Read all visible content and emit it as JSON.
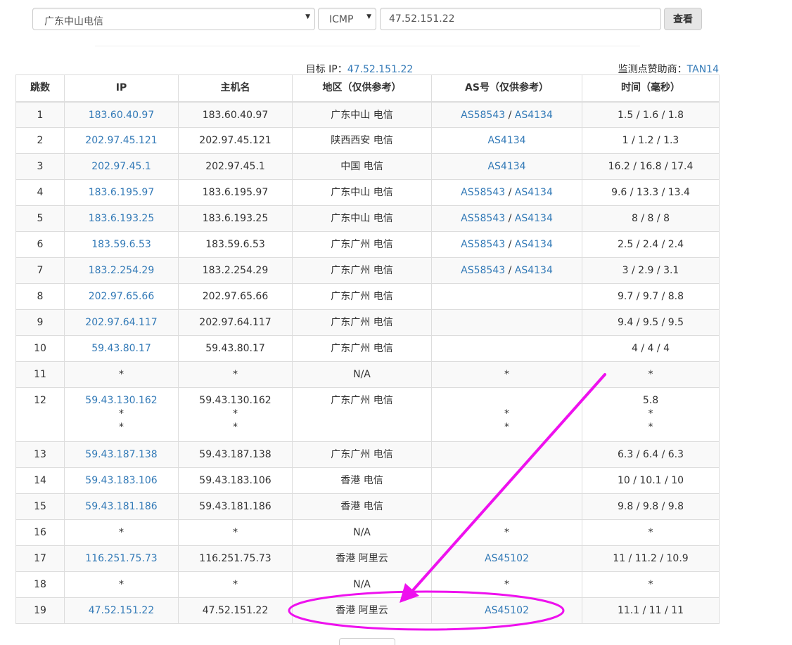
{
  "toolbar": {
    "region_select": {
      "value": "广东中山电信"
    },
    "protocol_select": {
      "value": "ICMP"
    },
    "target_input": {
      "value": "47.52.151.22"
    },
    "view_label": "查看"
  },
  "target": {
    "label": "目标 IP：",
    "ip": "47.52.151.22"
  },
  "sponsor": {
    "label": "监测点赞助商：",
    "name": "TAN14"
  },
  "table": {
    "headers": [
      "跳数",
      "IP",
      "主机名",
      "地区（仅供参考）",
      "AS号（仅供参考）",
      "时间（毫秒）"
    ],
    "rows": [
      {
        "hop": "1",
        "ip": "183.60.40.97",
        "host": "183.60.40.97",
        "region": "广东中山 电信",
        "as1": "AS58543",
        "sep": " / ",
        "as2": "AS4134",
        "time": "1.5 / 1.6 / 1.8"
      },
      {
        "hop": "2",
        "ip": "202.97.45.121",
        "host": "202.97.45.121",
        "region": "陕西西安 电信",
        "as1": "AS4134",
        "sep": "",
        "as2": "",
        "time": "1 / 1.2 / 1.3"
      },
      {
        "hop": "3",
        "ip": "202.97.45.1",
        "host": "202.97.45.1",
        "region": "中国 电信",
        "as1": "AS4134",
        "sep": "",
        "as2": "",
        "time": "16.2 / 16.8 / 17.4"
      },
      {
        "hop": "4",
        "ip": "183.6.195.97",
        "host": "183.6.195.97",
        "region": "广东中山 电信",
        "as1": "AS58543",
        "sep": " / ",
        "as2": "AS4134",
        "time": "9.6 / 13.3 / 13.4"
      },
      {
        "hop": "5",
        "ip": "183.6.193.25",
        "host": "183.6.193.25",
        "region": "广东中山 电信",
        "as1": "AS58543",
        "sep": " / ",
        "as2": "AS4134",
        "time": "8 / 8 / 8"
      },
      {
        "hop": "6",
        "ip": "183.59.6.53",
        "host": "183.59.6.53",
        "region": "广东广州 电信",
        "as1": "AS58543",
        "sep": " / ",
        "as2": "AS4134",
        "time": "2.5 / 2.4 / 2.4"
      },
      {
        "hop": "7",
        "ip": "183.2.254.29",
        "host": "183.2.254.29",
        "region": "广东广州 电信",
        "as1": "AS58543",
        "sep": " / ",
        "as2": "AS4134",
        "time": "3 / 2.9 / 3.1"
      },
      {
        "hop": "8",
        "ip": "202.97.65.66",
        "host": "202.97.65.66",
        "region": "广东广州 电信",
        "as1": "",
        "sep": "",
        "as2": "",
        "time": "9.7 / 9.7 / 8.8"
      },
      {
        "hop": "9",
        "ip": "202.97.64.117",
        "host": "202.97.64.117",
        "region": "广东广州 电信",
        "as1": "",
        "sep": "",
        "as2": "",
        "time": "9.4 / 9.5 / 9.5"
      },
      {
        "hop": "10",
        "ip": "59.43.80.17",
        "host": "59.43.80.17",
        "region": "广东广州 电信",
        "as1": "",
        "sep": "",
        "as2": "",
        "time": "4 / 4 / 4"
      },
      {
        "hop": "11",
        "ip_plain": "*",
        "host": "*",
        "region": "N/A",
        "as_plain": "*",
        "time": "*"
      },
      {
        "hop": "12",
        "ip": "59.43.130.162",
        "ip_extra1": "*",
        "ip_extra2": "*",
        "host": "59.43.130.162",
        "host_extra1": "*",
        "host_extra2": "*",
        "region": "广东广州 电信",
        "as_extra1": "*",
        "as_extra2": "*",
        "time": "5.8",
        "time_extra1": "*",
        "time_extra2": "*"
      },
      {
        "hop": "13",
        "ip": "59.43.187.138",
        "host": "59.43.187.138",
        "region": "广东广州 电信",
        "as1": "",
        "sep": "",
        "as2": "",
        "time": "6.3 / 6.4 / 6.3"
      },
      {
        "hop": "14",
        "ip": "59.43.183.106",
        "host": "59.43.183.106",
        "region": "香港 电信",
        "as1": "",
        "sep": "",
        "as2": "",
        "time": "10 / 10.1 / 10"
      },
      {
        "hop": "15",
        "ip": "59.43.181.186",
        "host": "59.43.181.186",
        "region": "香港 电信",
        "as1": "",
        "sep": "",
        "as2": "",
        "time": "9.8 / 9.8 / 9.8"
      },
      {
        "hop": "16",
        "ip_plain": "*",
        "host": "*",
        "region": "N/A",
        "as_plain": "*",
        "time": "*"
      },
      {
        "hop": "17",
        "ip": "116.251.75.73",
        "host": "116.251.75.73",
        "region": "香港 阿里云",
        "as1": "AS45102",
        "sep": "",
        "as2": "",
        "time": "11 / 11.2 / 10.9"
      },
      {
        "hop": "18",
        "ip_plain": "*",
        "host": "*",
        "region": "N/A",
        "as_plain": "*",
        "time": "*"
      },
      {
        "hop": "19",
        "ip": "47.52.151.22",
        "host": "47.52.151.22",
        "region": "香港 阿里云",
        "as1": "AS45102",
        "sep": "",
        "as2": "",
        "time": "11.1 / 11 / 11"
      }
    ]
  },
  "colors": {
    "link": "#337ab7",
    "annotation": "#ee11ee",
    "stripe": "#f9f9f9",
    "border": "#dddddd"
  },
  "icons": {
    "dropdown": "caret-down-icon",
    "annotation_arrow": "arrow-icon",
    "annotation_ellipse": "ellipse-highlight"
  }
}
